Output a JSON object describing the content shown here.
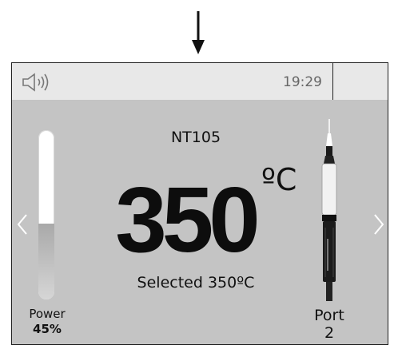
{
  "status_bar": {
    "time": "19:29",
    "sound_icon": "speaker-icon"
  },
  "power": {
    "label": "Power",
    "value_text": "45%",
    "level_fraction": 0.45
  },
  "tool": {
    "name": "NT105"
  },
  "temperature": {
    "value": "350",
    "unit": "ºC",
    "selected_text": "Selected 350ºC"
  },
  "port": {
    "label": "Port",
    "number": "2"
  },
  "icons": {
    "pointer": "arrow-down-icon",
    "nav_left": "chevron-left-icon",
    "nav_right": "chevron-right-icon",
    "handpiece": "soldering-handpiece-icon"
  },
  "colors": {
    "screen_background": "#c4c4c4",
    "status_bar_background": "#e8e8e8"
  }
}
